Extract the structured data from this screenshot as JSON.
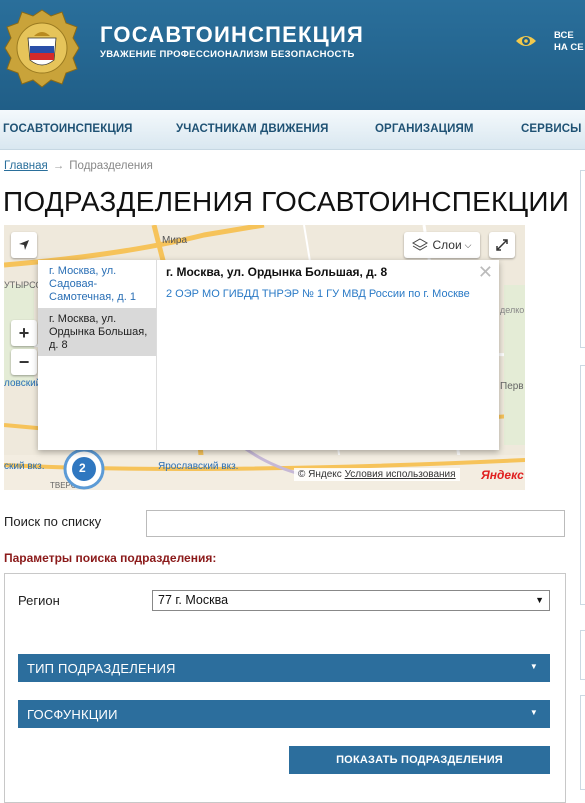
{
  "header": {
    "title": "ГОСАВТОИНСПЕКЦИЯ",
    "subtitle": "УВАЖЕНИЕ ПРОФЕССИОНАЛИЗМ БЕЗОПАСНОСТЬ",
    "vision_label": "ВСЕ\nНА СЕ"
  },
  "nav": {
    "items": [
      "ГОСАВТОИНСПЕКЦИЯ",
      "УЧАСТНИКАМ ДВИЖЕНИЯ",
      "ОРГАНИЗАЦИЯМ",
      "СЕРВИСЫ"
    ]
  },
  "breadcrumb": {
    "home": "Главная",
    "current": "Подразделения"
  },
  "page": {
    "title": "ПОДРАЗДЕЛЕНИЯ ГОСАВТОИНСПЕКЦИИ"
  },
  "map": {
    "layers_label": "Слои",
    "popup": {
      "list": [
        "г. Москва, ул. Садовая-Самотечная, д. 1",
        "г. Москва, ул. Ордынка Большая, д. 8"
      ],
      "selected_index": 1,
      "heading": "г. Москва, ул. Ордынка Большая, д. 8",
      "link": "2 ОЭР МО ГИБДД ТНРЭР № 1 ГУ МВД России по г. Москве"
    },
    "labels": [
      "Мира",
      "УТЫРСО",
      "ловский",
      "ский вкз.",
      "Ярославский вкз.",
      "ТВЕРСКО",
      "Перв",
      "делко"
    ],
    "cluster_count": "2",
    "copyright": "© Яндекс",
    "terms": "Условия использования",
    "brand": "Яндекс"
  },
  "search": {
    "label": "Поиск по списку",
    "value": ""
  },
  "filters": {
    "title": "Параметры поиска подразделения:",
    "region_label": "Регион",
    "region_value": "77 г. Москва",
    "type_label": "ТИП ПОДРАЗДЕЛЕНИЯ",
    "functions_label": "ГОСФУНКЦИИ",
    "submit_label": "ПОКАЗАТЬ ПОДРАЗДЕЛЕНИЯ"
  },
  "colors": {
    "header_blue": "#205e87",
    "button_blue": "#2c6e9d",
    "params_red": "#8b1a1a",
    "link_blue": "#2a6fb5"
  }
}
